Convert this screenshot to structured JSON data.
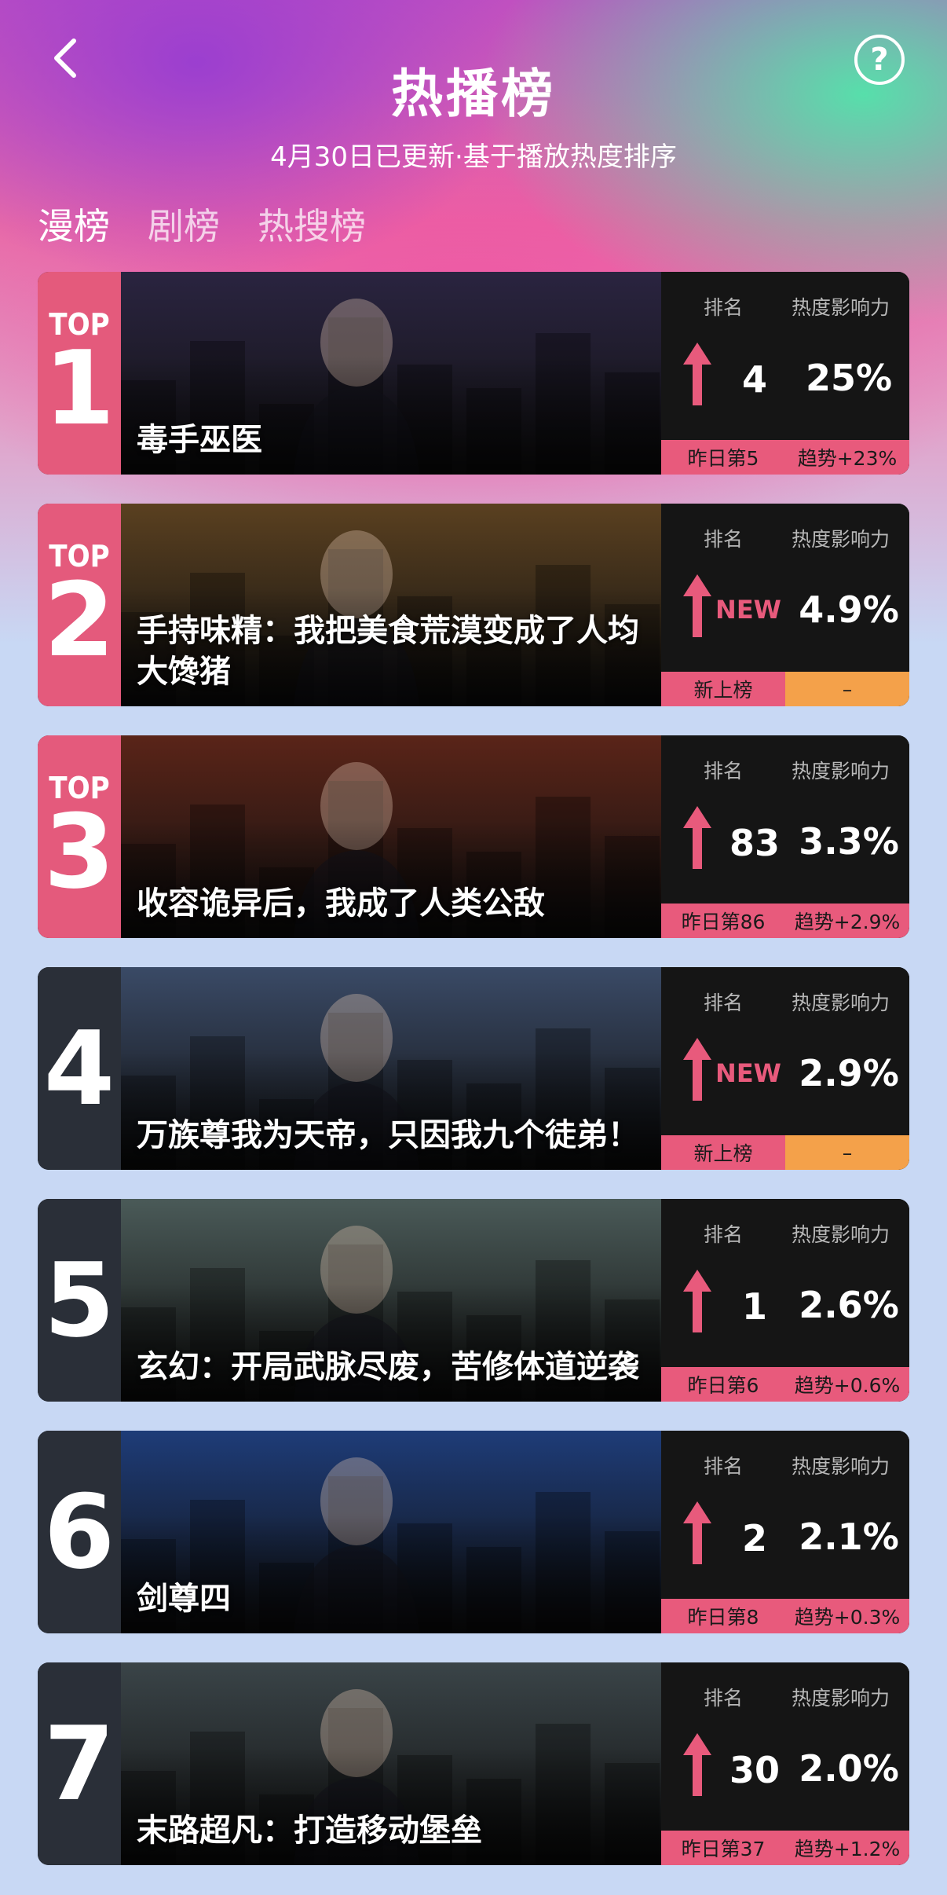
{
  "header": {
    "title": "热播榜",
    "subtitle": "4月30日已更新·基于播放热度排序",
    "back_icon": "chevron-left-icon",
    "help_label": "?"
  },
  "tabs": [
    {
      "label": "漫榜",
      "active": true
    },
    {
      "label": "剧榜",
      "active": false
    },
    {
      "label": "热搜榜",
      "active": false
    }
  ],
  "stat_headers": {
    "rank": "排名",
    "heat": "热度影响力"
  },
  "top_label": "TOP",
  "items": [
    {
      "rank": "1",
      "title": "毒手巫医",
      "rank_change": "4",
      "heat": "25%",
      "footer_left": "昨日第5",
      "footer_right": "趋势+23%",
      "poster_color": "#2a2440"
    },
    {
      "rank": "2",
      "title": "手持味精：我把美食荒漠变成了人均大馋猪",
      "rank_change": "NEW",
      "heat": "4.9%",
      "footer_left": "新上榜",
      "footer_right": "–",
      "poster_color": "#5a4020"
    },
    {
      "rank": "3",
      "title": "收容诡异后，我成了人类公敌",
      "rank_change": "83",
      "heat": "3.3%",
      "footer_left": "昨日第86",
      "footer_right": "趋势+2.9%",
      "poster_color": "#5a2418"
    },
    {
      "rank": "4",
      "title": "万族尊我为天帝，只因我九个徒弟！",
      "rank_change": "NEW",
      "heat": "2.9%",
      "footer_left": "新上榜",
      "footer_right": "–",
      "poster_color": "#3a4a66"
    },
    {
      "rank": "5",
      "title": "玄幻：开局武脉尽废，苦修体道逆袭",
      "rank_change": "1",
      "heat": "2.6%",
      "footer_left": "昨日第6",
      "footer_right": "趋势+0.6%",
      "poster_color": "#4a5a58"
    },
    {
      "rank": "6",
      "title": "剑尊四",
      "rank_change": "2",
      "heat": "2.1%",
      "footer_left": "昨日第8",
      "footer_right": "趋势+0.3%",
      "poster_color": "#1e3c78"
    },
    {
      "rank": "7",
      "title": "末路超凡：打造移动堡垒",
      "rank_change": "30",
      "heat": "2.0%",
      "footer_left": "昨日第37",
      "footer_right": "趋势+1.2%",
      "poster_color": "#3a4448"
    }
  ]
}
